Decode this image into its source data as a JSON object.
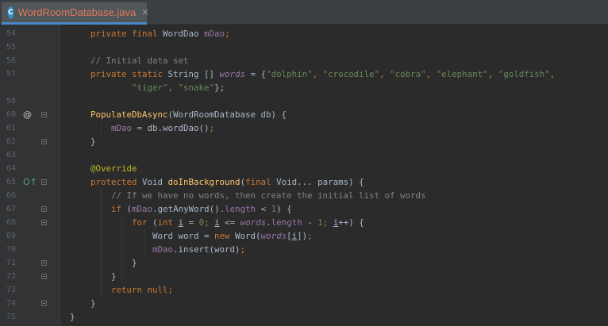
{
  "tab": {
    "file_icon_letter": "C",
    "title": "WordRoomDatabase.java",
    "close_glyph": "✕"
  },
  "gutter_markers": {
    "line_60": "@",
    "line_65": "O↑"
  },
  "lines": [
    {
      "n": "54",
      "segs": [
        [
          "        ",
          ""
        ],
        [
          "private final ",
          "kw"
        ],
        [
          "WordDao ",
          ""
        ],
        [
          "mDao",
          "fld"
        ],
        [
          ";",
          "kw"
        ]
      ]
    },
    {
      "n": "55",
      "segs": []
    },
    {
      "n": "56",
      "segs": [
        [
          "        ",
          ""
        ],
        [
          "// Initial data set",
          "cmt"
        ]
      ]
    },
    {
      "n": "57",
      "segs": [
        [
          "        ",
          ""
        ],
        [
          "private static ",
          "kw"
        ],
        [
          "String [] ",
          ""
        ],
        [
          "words",
          "fldi"
        ],
        [
          " = {",
          ""
        ],
        [
          "\"dolphin\"",
          "str"
        ],
        [
          ", ",
          "kw"
        ],
        [
          "\"crocodile\"",
          "str"
        ],
        [
          ", ",
          "kw"
        ],
        [
          "\"cobra\"",
          "str"
        ],
        [
          ", ",
          "kw"
        ],
        [
          "\"elephant\"",
          "str"
        ],
        [
          ", ",
          "kw"
        ],
        [
          "\"goldfish\"",
          "str"
        ],
        [
          ",",
          "kw"
        ]
      ]
    },
    {
      "n": "",
      "segs": [
        [
          "                ",
          ""
        ],
        [
          "\"tiger\"",
          "str"
        ],
        [
          ", ",
          "kw"
        ],
        [
          "\"snake\"",
          "str"
        ],
        [
          "};",
          ""
        ]
      ]
    },
    {
      "n": "58",
      "segs": []
    },
    {
      "n": "60",
      "segs": [
        [
          "        ",
          ""
        ],
        [
          "PopulateDbAsync",
          "fn"
        ],
        [
          "(WordRoomDatabase db) {",
          ""
        ]
      ]
    },
    {
      "n": "61",
      "segs": [
        [
          "            ",
          ""
        ],
        [
          "mDao",
          "fld"
        ],
        [
          " = db.wordDao()",
          ""
        ],
        [
          ";",
          "kw"
        ]
      ]
    },
    {
      "n": "62",
      "segs": [
        [
          "        ",
          ""
        ],
        [
          "}",
          ""
        ]
      ]
    },
    {
      "n": "63",
      "segs": []
    },
    {
      "n": "64",
      "segs": [
        [
          "        ",
          ""
        ],
        [
          "@Override",
          "ann"
        ]
      ]
    },
    {
      "n": "65",
      "segs": [
        [
          "        ",
          ""
        ],
        [
          "protected ",
          "kw"
        ],
        [
          "Void ",
          ""
        ],
        [
          "doInBackground",
          "fn"
        ],
        [
          "(",
          ""
        ],
        [
          "final ",
          "kw"
        ],
        [
          "Void... params) {",
          ""
        ]
      ]
    },
    {
      "n": "66",
      "segs": [
        [
          "            ",
          ""
        ],
        [
          "// If we have no words, then create the initial list of words",
          "cmt"
        ]
      ]
    },
    {
      "n": "67",
      "segs": [
        [
          "            ",
          ""
        ],
        [
          "if ",
          "kw"
        ],
        [
          "(",
          ""
        ],
        [
          "mDao",
          "fld"
        ],
        [
          ".getAnyWord().",
          ""
        ],
        [
          "length",
          "fld"
        ],
        [
          " < ",
          ""
        ],
        [
          "1",
          "str"
        ],
        [
          ") {",
          ""
        ]
      ]
    },
    {
      "n": "68",
      "segs": [
        [
          "                ",
          ""
        ],
        [
          "for ",
          "kw"
        ],
        [
          "(",
          ""
        ],
        [
          "int ",
          "kw"
        ],
        [
          "i",
          "ul"
        ],
        [
          " = ",
          ""
        ],
        [
          "0",
          "str"
        ],
        [
          "; ",
          "kw"
        ],
        [
          "i",
          "ul"
        ],
        [
          " <= ",
          ""
        ],
        [
          "words",
          "fldi"
        ],
        [
          ".",
          ""
        ],
        [
          "length",
          "fld"
        ],
        [
          " - ",
          ""
        ],
        [
          "1",
          "str"
        ],
        [
          "; ",
          "kw"
        ],
        [
          "i",
          "ul"
        ],
        [
          "++) {",
          ""
        ]
      ]
    },
    {
      "n": "69",
      "segs": [
        [
          "                    ",
          ""
        ],
        [
          "Word word = ",
          ""
        ],
        [
          "new ",
          "kw"
        ],
        [
          "Word(",
          ""
        ],
        [
          "words",
          "fldi"
        ],
        [
          "[",
          ""
        ],
        [
          "i",
          "ul"
        ],
        [
          "])",
          ""
        ],
        [
          ";",
          "kw"
        ]
      ]
    },
    {
      "n": "70",
      "segs": [
        [
          "                    ",
          ""
        ],
        [
          "mDao",
          "fld"
        ],
        [
          ".insert(word)",
          ""
        ],
        [
          ";",
          "kw"
        ]
      ]
    },
    {
      "n": "71",
      "segs": [
        [
          "                ",
          ""
        ],
        [
          "}",
          ""
        ]
      ]
    },
    {
      "n": "72",
      "segs": [
        [
          "            ",
          ""
        ],
        [
          "}",
          ""
        ]
      ]
    },
    {
      "n": "73",
      "segs": [
        [
          "            ",
          ""
        ],
        [
          "return null",
          "kw"
        ],
        [
          ";",
          "kw"
        ]
      ]
    },
    {
      "n": "74",
      "segs": [
        [
          "        ",
          ""
        ],
        [
          "}",
          ""
        ]
      ]
    },
    {
      "n": "75",
      "segs": [
        [
          "    ",
          ""
        ],
        [
          "}",
          ""
        ]
      ]
    }
  ]
}
